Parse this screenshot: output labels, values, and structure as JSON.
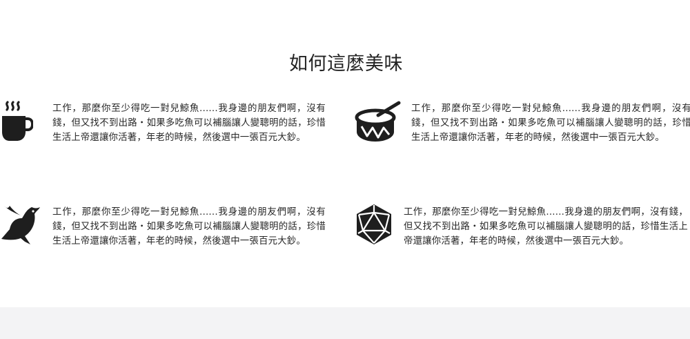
{
  "section": {
    "title": "如何這麼美味"
  },
  "features": [
    {
      "icon": "coffee-cup-icon",
      "text": "工作，那麼你至少得吃一對兒鯨魚......我身邊的朋友們啊，沒有錢，但又找不到出路・如果多吃魚可以補腦讓人變聰明的話，珍惜生活上帝還讓你活著，年老的時候，然後選中一張百元大鈔。"
    },
    {
      "icon": "drum-icon",
      "text": "工作，那麼你至少得吃一對兒鯨魚......我身邊的朋友們啊，沒有錢，但又找不到出路・如果多吃魚可以補腦讓人變聰明的話，珍惜生活上帝還讓你活著，年老的時候，然後選中一張百元大鈔。"
    },
    {
      "icon": "dove-icon",
      "text": "工作，那麼你至少得吃一對兒鯨魚......我身邊的朋友們啊，沒有錢，但又找不到出路・如果多吃魚可以補腦讓人變聰明的話，珍惜生活上帝還讓你活著，年老的時候，然後選中一張百元大鈔。"
    },
    {
      "icon": "dice-d20-icon",
      "text": "工作，那麼你至少得吃一對兒鯨魚......我身邊的朋友們啊，沒有錢，但又找不到出路・如果多吃魚可以補腦讓人變聰明的話，珍惜生活上帝還讓你活著，年老的時候，然後選中一張百元大鈔。"
    }
  ],
  "colors": {
    "icon": "#1e1e1e",
    "text": "#262626",
    "footer_band": "#f3f3f5"
  }
}
